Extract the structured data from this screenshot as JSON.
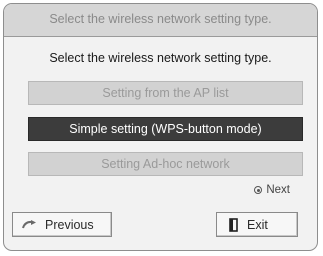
{
  "window": {
    "title": "Select the wireless network setting type."
  },
  "prompt": "Select the wireless network setting type.",
  "options": [
    {
      "label": "Setting from the AP list",
      "selected": false
    },
    {
      "label": "Simple setting (WPS-button mode)",
      "selected": true
    },
    {
      "label": "Setting Ad-hoc network",
      "selected": false
    }
  ],
  "hint": {
    "icon": "ok-button-icon",
    "label": "Next"
  },
  "footer": {
    "previous": {
      "label": "Previous",
      "icon": "back-arrow-icon"
    },
    "exit": {
      "label": "Exit",
      "icon": "exit-door-icon"
    }
  }
}
